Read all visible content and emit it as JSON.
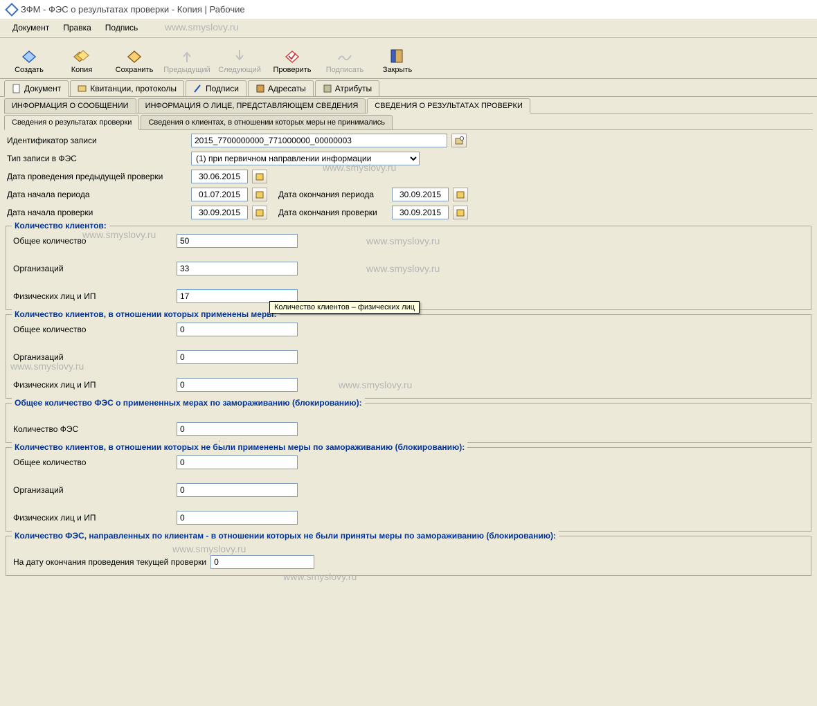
{
  "title": "ЗФМ - ФЭС о результатах проверки - Копия | Рабочие",
  "menu": {
    "document": "Документ",
    "edit": "Правка",
    "sign": "Подпись"
  },
  "watermark": "www.smyslovy.ru",
  "toolbar": {
    "create": "Создать",
    "copy": "Копия",
    "save": "Сохранить",
    "prev": "Предыдущий",
    "next": "Следующий",
    "check": "Проверить",
    "sign": "Подписать",
    "close": "Закрыть"
  },
  "tabs": {
    "document": "Документ",
    "receipts": "Квитанции, протоколы",
    "signs": "Подписи",
    "addressees": "Адресаты",
    "attributes": "Атрибуты"
  },
  "subtabs1": {
    "info_msg": "ИНФОРМАЦИЯ О СООБЩЕНИИ",
    "info_person": "ИНФОРМАЦИЯ О ЛИЦЕ, ПРЕДСТАВЛЯЮЩЕМ СВЕДЕНИЯ",
    "results": "СВЕДЕНИЯ О РЕЗУЛЬТАТАХ ПРОВЕРКИ"
  },
  "subtabs2": {
    "results": "Сведения о результатах проверки",
    "clients": "Сведения о клиентах, в отношении которых меры не принимались"
  },
  "fields": {
    "record_id_label": "Идентификатор записи",
    "record_id": "2015_7700000000_771000000_00000003",
    "record_type_label": "Тип записи в ФЭС",
    "record_type": "(1) при первичном направлении информации",
    "prev_check_date_label": "Дата проведения предыдущей проверки",
    "prev_check_date": "30.06.2015",
    "period_start_label": "Дата начала периода",
    "period_start": "01.07.2015",
    "period_end_label": "Дата окончания периода",
    "period_end": "30.09.2015",
    "check_start_label": "Дата начала проверки",
    "check_start": "30.09.2015",
    "check_end_label": "Дата окончания проверки",
    "check_end": "30.09.2015"
  },
  "group1": {
    "title": "Количество клиентов:",
    "total_label": "Общее количество",
    "total": "50",
    "org_label": "Организаций",
    "org": "33",
    "phys_label": "Физических лиц и ИП",
    "phys": "17"
  },
  "tooltip": "Количество клиентов – физических лиц",
  "group2": {
    "title": "Количество клиентов, в отношении которых применены меры:",
    "total_label": "Общее количество",
    "total": "0",
    "org_label": "Организаций",
    "org": "0",
    "phys_label": "Физических лиц и ИП",
    "phys": "0"
  },
  "group3": {
    "title": "Общее количество ФЭС о примененных мерах по замораживанию (блокированию):",
    "count_label": "Количество ФЭС",
    "count": "0"
  },
  "group4": {
    "title": "Количество клиентов, в отношении которых не были применены меры по замораживанию (блокированию):",
    "total_label": "Общее количество",
    "total": "0",
    "org_label": "Организаций",
    "org": "0",
    "phys_label": "Физических лиц и ИП",
    "phys": "0"
  },
  "group5": {
    "title": "Количество ФЭС, направленных по клиентам - в отношении которых не были приняты меры по замораживанию (блокированию):",
    "date_label": "На дату окончания проведения текущей проверки",
    "date_val": "0"
  }
}
